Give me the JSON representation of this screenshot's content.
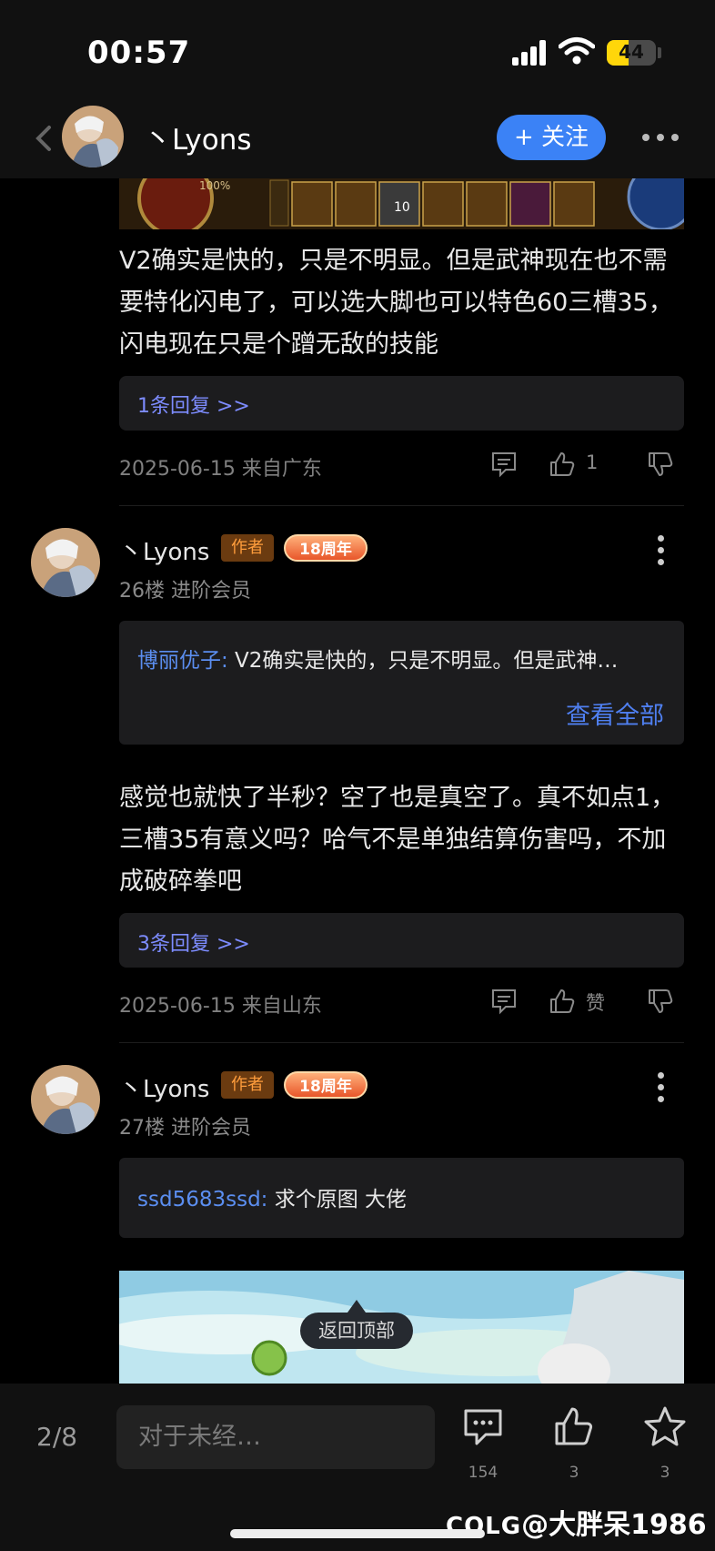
{
  "status": {
    "time": "00:57",
    "battery": "44",
    "battery_level": 0.44
  },
  "header": {
    "username": "丶Lyons",
    "follow_label": "+ 关注"
  },
  "comment1": {
    "text": "V2确实是快的，只是不明显。但是武神现在也不需要特化闪电了，可以选大脚也可以特色60三槽35，闪电现在只是个蹭无敌的技能",
    "replies": "1条回复 >>",
    "meta": "2025-06-15 来自广东",
    "likes": "1"
  },
  "post26": {
    "name": "丶Lyons",
    "author_badge": "作者",
    "anniv_badge": "18周年",
    "floor": "26楼  进阶会员",
    "quote_user": "博丽优子:",
    "quote_text": " V2确实是快的，只是不明显。但是武神…",
    "view_all": "查看全部",
    "text": "感觉也就快了半秒？空了也是真空了。真不如点1，三槽35有意义吗？哈气不是单独结算伤害吗，不加成破碎拳吧",
    "replies": "3条回复 >>",
    "meta": "2025-06-15 来自山东",
    "like_label": "赞"
  },
  "post27": {
    "name": "丶Lyons",
    "author_badge": "作者",
    "anniv_badge": "18周年",
    "floor": "27楼  进阶会员",
    "quote_user": "ssd5683ssd:",
    "quote_text": " 求个原图 大佬"
  },
  "back_to_top": "返回顶部",
  "bottom": {
    "pager": "2/8",
    "input_placeholder": "对于未经…",
    "comments": "154",
    "likes": "3",
    "favorites": "3"
  },
  "watermark": "@大胖呆1986",
  "watermark_logo": "COLG"
}
